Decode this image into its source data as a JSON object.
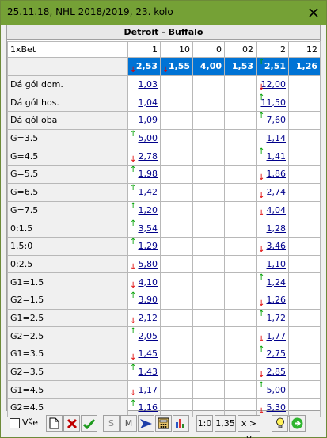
{
  "window": {
    "title": "25.11.18, NHL 2018/2019, 23. kolo"
  },
  "match": {
    "title": "Detroit - Buffalo"
  },
  "bookmaker": "1xBet",
  "columns": [
    "1",
    "10",
    "0",
    "02",
    "2",
    "12"
  ],
  "base_odds": [
    {
      "value": "2,53",
      "move": "down"
    },
    {
      "value": "1,55",
      "move": "down"
    },
    {
      "value": "4,00",
      "move": ""
    },
    {
      "value": "1,53",
      "move": ""
    },
    {
      "value": "2,51",
      "move": "up"
    },
    {
      "value": "1,26",
      "move": ""
    }
  ],
  "rows": [
    {
      "label": "Dá gól dom.",
      "c1": {
        "value": "1,03",
        "move": ""
      },
      "c2": {
        "value": "12,00",
        "move": "down"
      }
    },
    {
      "label": "Dá gól hos.",
      "c1": {
        "value": "1,04",
        "move": ""
      },
      "c2": {
        "value": "11,50",
        "move": "up"
      }
    },
    {
      "label": "Dá gól oba",
      "c1": {
        "value": "1,09",
        "move": ""
      },
      "c2": {
        "value": "7,60",
        "move": "up"
      }
    },
    {
      "label": "G=3.5",
      "c1": {
        "value": "5,00",
        "move": "up"
      },
      "c2": {
        "value": "1,14",
        "move": ""
      }
    },
    {
      "label": "G=4.5",
      "c1": {
        "value": "2,78",
        "move": "down"
      },
      "c2": {
        "value": "1,41",
        "move": "up"
      }
    },
    {
      "label": "G=5.5",
      "c1": {
        "value": "1,98",
        "move": "up"
      },
      "c2": {
        "value": "1,86",
        "move": "down"
      }
    },
    {
      "label": "G=6.5",
      "c1": {
        "value": "1,42",
        "move": "up"
      },
      "c2": {
        "value": "2,74",
        "move": "down"
      }
    },
    {
      "label": "G=7.5",
      "c1": {
        "value": "1,20",
        "move": "up"
      },
      "c2": {
        "value": "4,04",
        "move": "down"
      }
    },
    {
      "label": "0:1.5",
      "c1": {
        "value": "3,54",
        "move": "up"
      },
      "c2": {
        "value": "1,28",
        "move": ""
      }
    },
    {
      "label": "1.5:0",
      "c1": {
        "value": "1,29",
        "move": "up"
      },
      "c2": {
        "value": "3,46",
        "move": "down"
      }
    },
    {
      "label": "0:2.5",
      "c1": {
        "value": "5,80",
        "move": "down"
      },
      "c2": {
        "value": "1,10",
        "move": ""
      }
    },
    {
      "label": "G1=1.5",
      "c1": {
        "value": "4,10",
        "move": "down"
      },
      "c2": {
        "value": "1,24",
        "move": "up"
      }
    },
    {
      "label": "G2=1.5",
      "c1": {
        "value": "3,90",
        "move": "up"
      },
      "c2": {
        "value": "1,26",
        "move": "down"
      }
    },
    {
      "label": "G1=2.5",
      "c1": {
        "value": "2,12",
        "move": "down"
      },
      "c2": {
        "value": "1,72",
        "move": "up"
      }
    },
    {
      "label": "G2=2.5",
      "c1": {
        "value": "2,05",
        "move": "up"
      },
      "c2": {
        "value": "1,77",
        "move": "down"
      }
    },
    {
      "label": "G1=3.5",
      "c1": {
        "value": "1,45",
        "move": "down"
      },
      "c2": {
        "value": "2,75",
        "move": "up"
      }
    },
    {
      "label": "G2=3.5",
      "c1": {
        "value": "1,43",
        "move": "up"
      },
      "c2": {
        "value": "2,85",
        "move": "down"
      }
    },
    {
      "label": "G1=4.5",
      "c1": {
        "value": "1,17",
        "move": "down"
      },
      "c2": {
        "value": "5,00",
        "move": "up"
      }
    },
    {
      "label": "G2=4.5",
      "c1": {
        "value": "1,16",
        "move": "up"
      },
      "c2": {
        "value": "5,30",
        "move": "down"
      }
    }
  ],
  "toolbar": {
    "all_label": "Vše",
    "s_label": "S",
    "m_label": "M",
    "score_label": "1:0",
    "odds_label": "1,35",
    "compare_label": "x > y"
  },
  "colors": {
    "titlebar": "#75a136",
    "base_row": "#0073d5",
    "odds_text": "#00008b",
    "up": "#00a000",
    "down": "#e00000"
  },
  "icons": [
    "close-icon",
    "new-document-icon",
    "delete-icon",
    "confirm-check-icon",
    "arrow-forward-icon",
    "calculator-icon",
    "bar-chart-icon",
    "bulb-icon",
    "go-arrow-icon",
    "up-arrow-icon",
    "down-arrow-icon"
  ]
}
